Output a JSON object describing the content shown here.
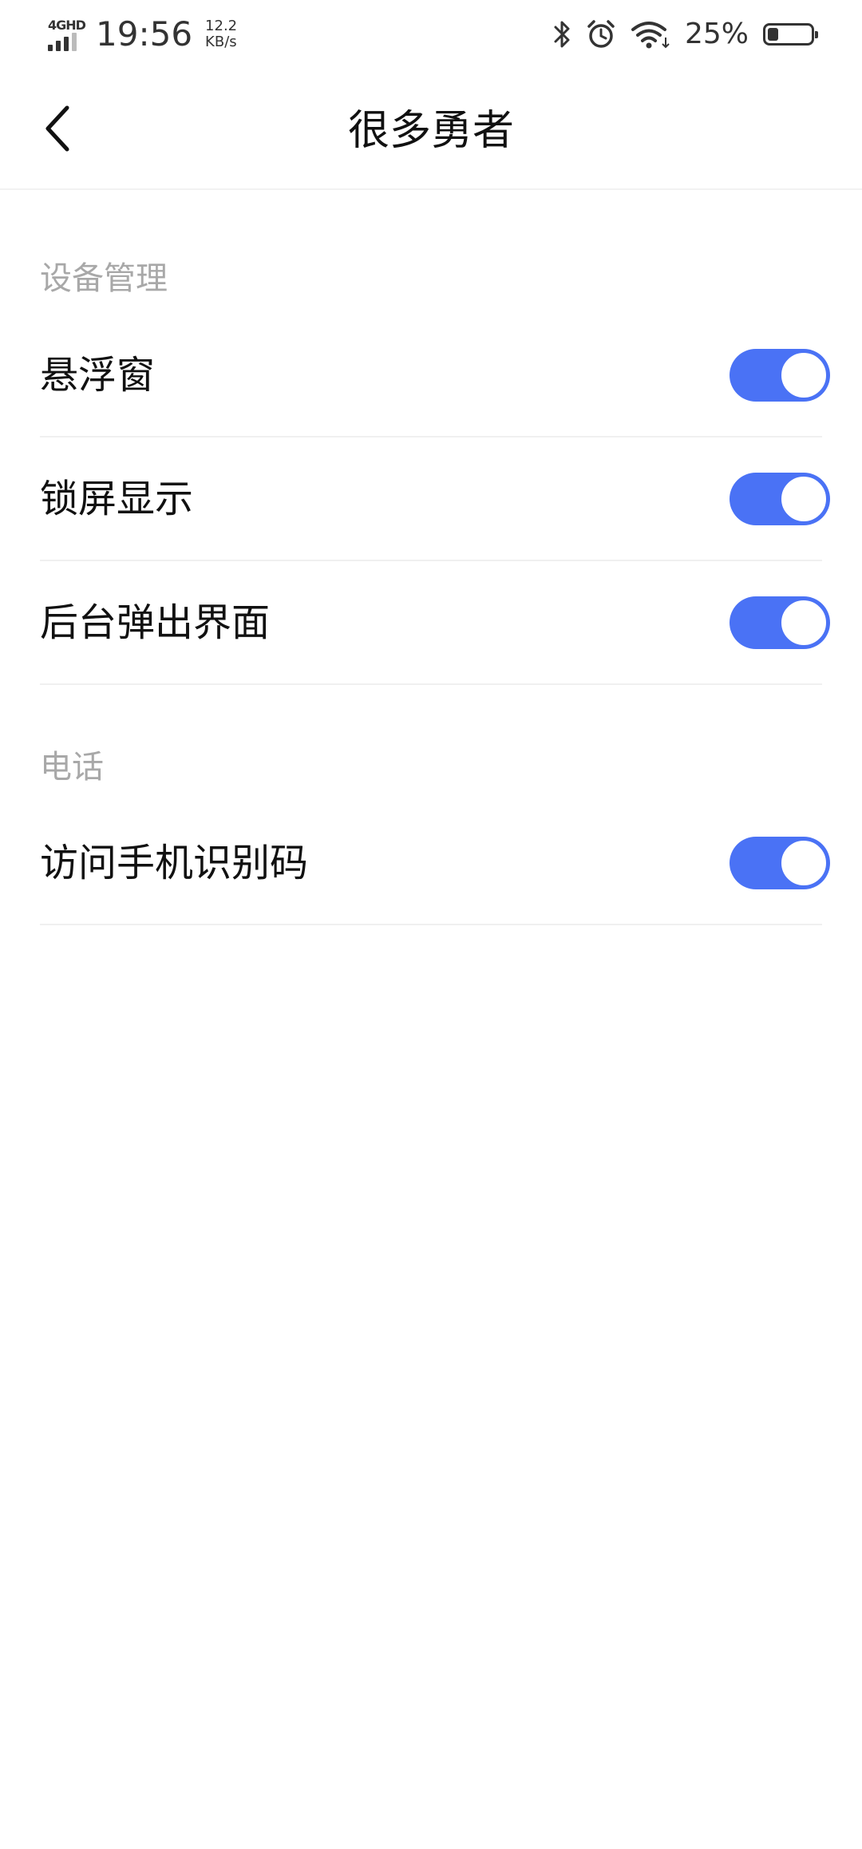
{
  "status_bar": {
    "network": "4GHD",
    "signal_level": 3,
    "time": "19:56",
    "speed_value": "12.2",
    "speed_unit": "KB/s",
    "icons": [
      "bluetooth-icon",
      "alarm-icon",
      "wifi-icon"
    ],
    "battery_percent_text": "25%",
    "battery_level": 0.25
  },
  "header": {
    "title": "很多勇者",
    "back_icon": "chevron-left-icon"
  },
  "sections": [
    {
      "title": "设备管理",
      "items": [
        {
          "label": "悬浮窗",
          "enabled": true
        },
        {
          "label": "锁屏显示",
          "enabled": true
        },
        {
          "label": "后台弹出界面",
          "enabled": true
        }
      ]
    },
    {
      "title": "电话",
      "items": [
        {
          "label": "访问手机识别码",
          "enabled": true
        }
      ]
    }
  ],
  "colors": {
    "accent": "#4a72f5",
    "section_header": "#a8a8a8",
    "divider": "#f0f0f0"
  }
}
